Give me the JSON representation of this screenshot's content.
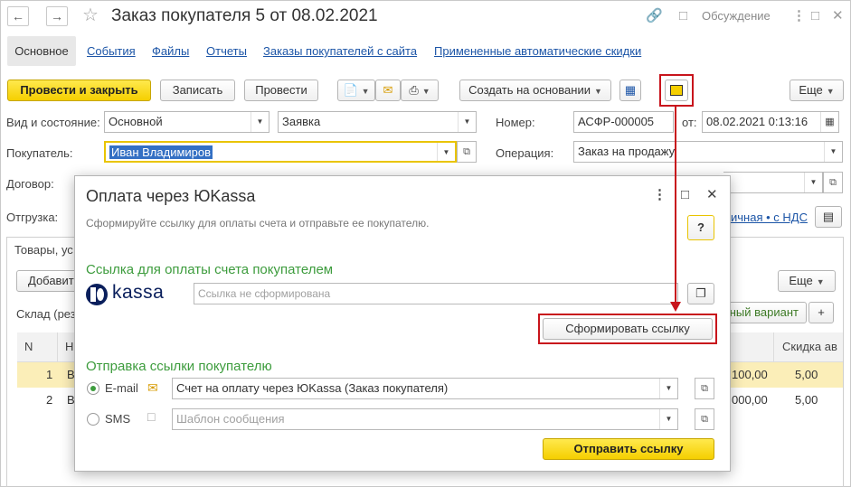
{
  "window": {
    "title": "Заказ покупателя 5 от 08.02.2021",
    "discussion": "Обсуждение"
  },
  "tabs": [
    {
      "label": "Основное"
    },
    {
      "label": "События"
    },
    {
      "label": "Файлы"
    },
    {
      "label": "Отчеты"
    },
    {
      "label": "Заказы покупателей с сайта"
    },
    {
      "label": "Примененные автоматические скидки"
    }
  ],
  "toolbar": {
    "post_close": "Провести и закрыть",
    "save": "Записать",
    "post": "Провести",
    "create_based": "Создать на основании",
    "more": "Еще"
  },
  "form": {
    "state_label": "Вид и состояние:",
    "state_value": "Основной",
    "kind_value": "Заявка",
    "number_label": "Номер:",
    "number_value": "АСФР-000005",
    "date_label": "от:",
    "date_value": "08.02.2021  0:13:16",
    "buyer_label": "Покупатель:",
    "buyer_value": "Иван Владимиров",
    "operation_label": "Операция:",
    "operation_value": "Заказ на продажу",
    "contract_label": "Договор:",
    "shipment_label": "Отгрузка:",
    "vat_link": "ичная • с НДС"
  },
  "goods": {
    "tab_label": "Товары, ус",
    "add_btn": "Добавит",
    "more": "Еще",
    "warehouse_label": "Склад (рез",
    "variant_btn": "ный вариант",
    "plus": "+",
    "col_n": "N",
    "col_name": "Н",
    "col_discount": "Скидка ав",
    "rows": [
      {
        "n": "1",
        "name": "В",
        "sum": "100,00",
        "discount": "5,00"
      },
      {
        "n": "2",
        "name": "В",
        "sum": "000,00",
        "discount": "5,00"
      }
    ]
  },
  "modal": {
    "title": "Оплата через ЮKassa",
    "subtitle": "Сформируйте ссылку для оплаты счета и отправьте ее покупателю.",
    "help": "?",
    "section_link": "Ссылка для оплаты счета покупателем",
    "logo_text": "kassa",
    "link_placeholder": "Ссылка не сформирована",
    "generate_btn": "Сформировать ссылку",
    "section_send": "Отправка ссылки покупателю",
    "email_label": "E-mail",
    "email_template": "Счет на оплату через ЮKassa (Заказ покупателя)",
    "sms_label": "SMS",
    "sms_placeholder": "Шаблон сообщения",
    "send_btn": "Отправить ссылку"
  },
  "colors": {
    "accent_yellow": "#f5cf00",
    "highlight_red": "#c8141c",
    "link_blue": "#1c55a7",
    "section_green": "#3d9c3d"
  }
}
